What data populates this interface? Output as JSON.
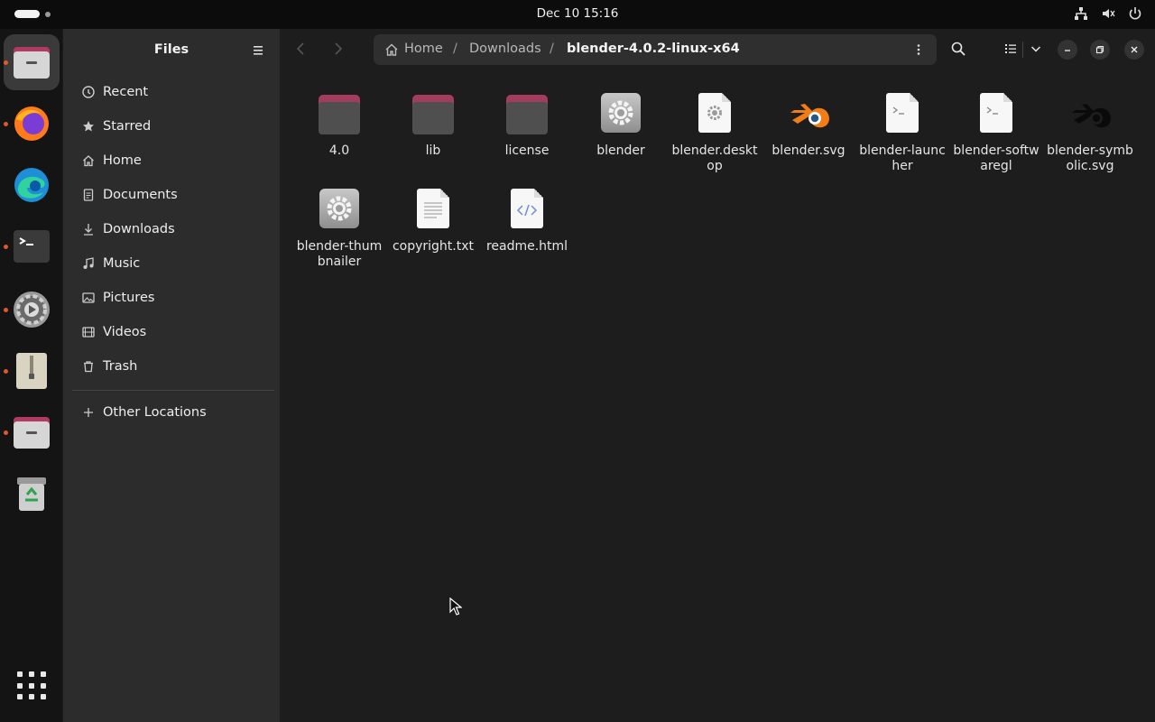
{
  "topbar": {
    "clock": "Dec 10  15:16",
    "tray_icons": [
      "network-icon",
      "volume-muted-icon",
      "power-icon"
    ]
  },
  "dock": {
    "items": [
      {
        "name": "files",
        "icon": "files-icon",
        "active": true,
        "running": true
      },
      {
        "name": "firefox",
        "icon": "firefox-icon",
        "active": false,
        "running": true
      },
      {
        "name": "edge",
        "icon": "edge-icon",
        "active": false,
        "running": false
      },
      {
        "name": "terminal",
        "icon": "terminal-icon",
        "active": false,
        "running": true
      },
      {
        "name": "settings",
        "icon": "settings-icon",
        "active": false,
        "running": true
      },
      {
        "name": "archive-manager",
        "icon": "archive-icon",
        "active": false,
        "running": true
      },
      {
        "name": "files-2",
        "icon": "files-icon",
        "active": false,
        "running": true
      },
      {
        "name": "trash",
        "icon": "trash-icon",
        "active": false,
        "running": false
      }
    ],
    "show_apps_icon": "app-grid-icon"
  },
  "sidebar": {
    "title": "Files",
    "items": [
      {
        "label": "Recent",
        "icon": "clock-icon"
      },
      {
        "label": "Starred",
        "icon": "star-icon"
      },
      {
        "label": "Home",
        "icon": "home-icon"
      },
      {
        "label": "Documents",
        "icon": "document-icon"
      },
      {
        "label": "Downloads",
        "icon": "download-icon"
      },
      {
        "label": "Music",
        "icon": "music-icon"
      },
      {
        "label": "Pictures",
        "icon": "picture-icon"
      },
      {
        "label": "Videos",
        "icon": "video-icon"
      },
      {
        "label": "Trash",
        "icon": "trash-icon"
      }
    ],
    "other_locations": {
      "label": "Other Locations",
      "icon": "plus-icon"
    }
  },
  "header": {
    "breadcrumbs": [
      "Home",
      "Downloads",
      "blender-4.0.2-linux-x64"
    ],
    "separator": "/"
  },
  "files": [
    {
      "name": "4.0",
      "type": "folder"
    },
    {
      "name": "lib",
      "type": "folder"
    },
    {
      "name": "license",
      "type": "folder"
    },
    {
      "name": "blender",
      "type": "executable"
    },
    {
      "name": "blender.desktop",
      "type": "desktop"
    },
    {
      "name": "blender.svg",
      "type": "blender-logo"
    },
    {
      "name": "blender-launcher",
      "type": "script"
    },
    {
      "name": "blender-softwaregl",
      "type": "script"
    },
    {
      "name": "blender-symbolic.svg",
      "type": "blender-symbolic"
    },
    {
      "name": "blender-thumbnailer",
      "type": "executable"
    },
    {
      "name": "copyright.txt",
      "type": "text"
    },
    {
      "name": "readme.html",
      "type": "html"
    }
  ],
  "colors": {
    "accent": "#e2572b",
    "folder_tab": "#a23d5e",
    "sidebar_bg": "#2c2c2c",
    "content_bg": "#1d1d1d"
  }
}
